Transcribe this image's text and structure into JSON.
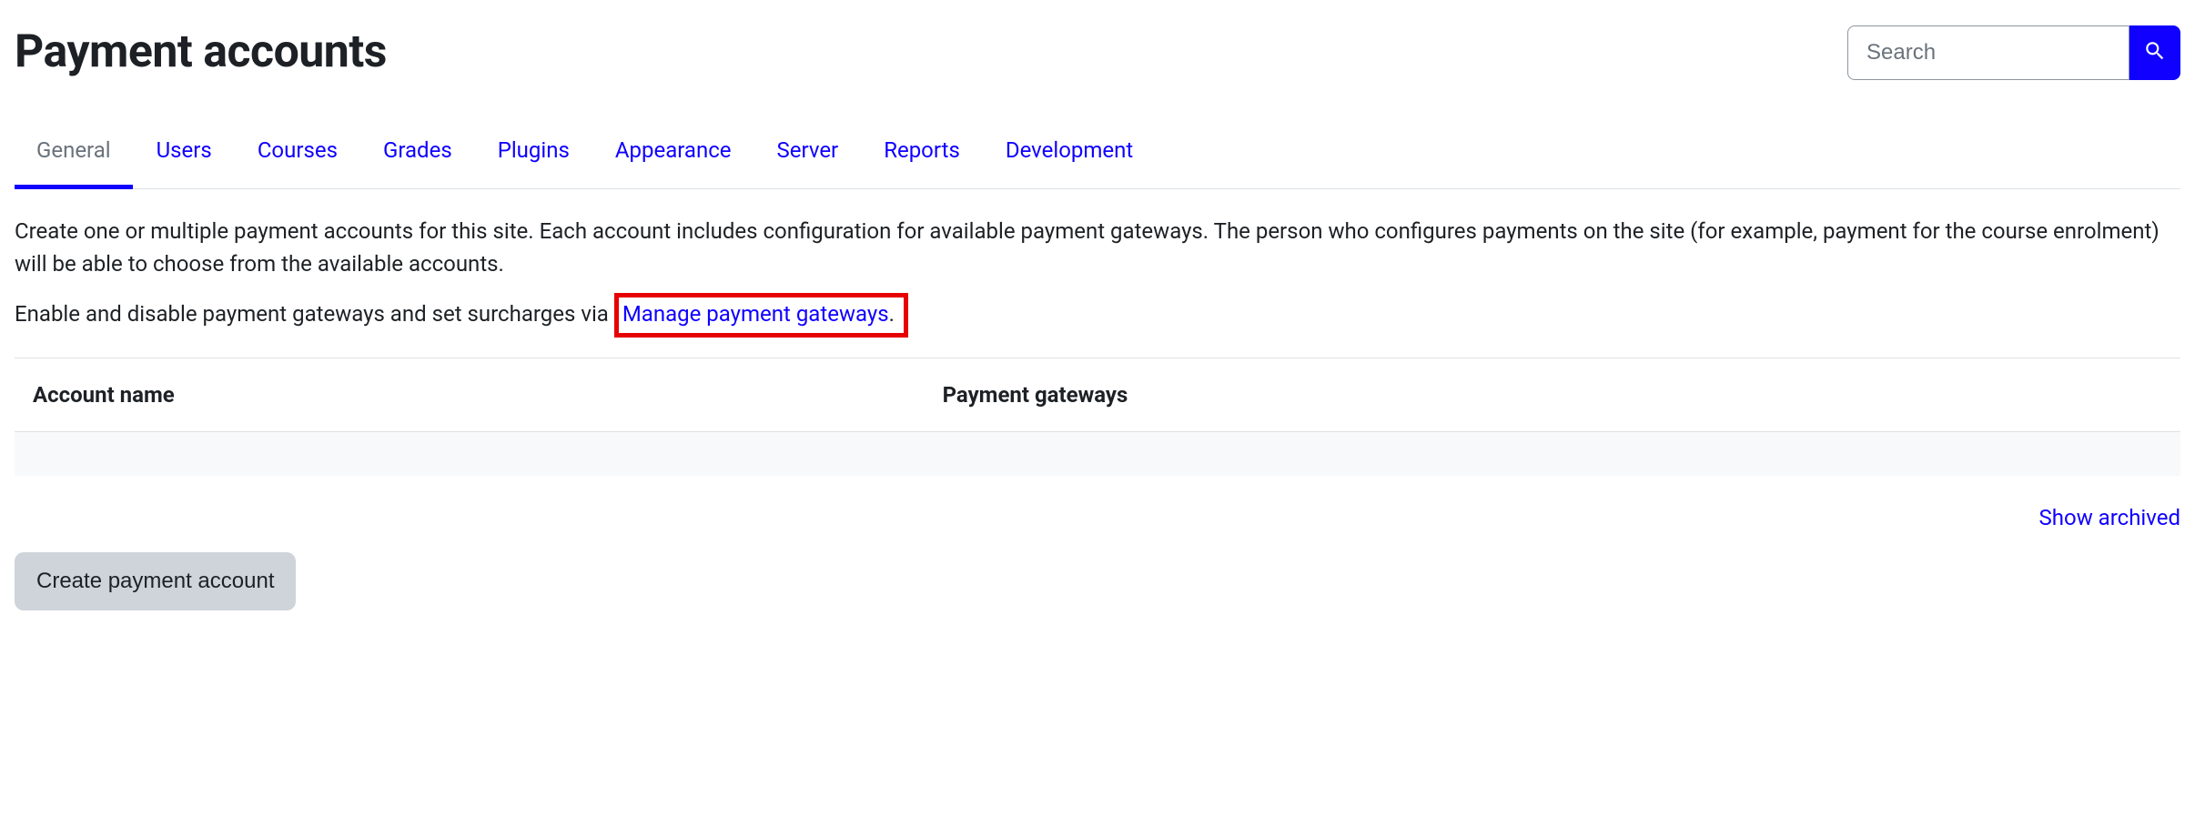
{
  "header": {
    "title": "Payment accounts",
    "search_placeholder": "Search"
  },
  "tabs": [
    {
      "label": "General",
      "active": true
    },
    {
      "label": "Users"
    },
    {
      "label": "Courses"
    },
    {
      "label": "Grades"
    },
    {
      "label": "Plugins"
    },
    {
      "label": "Appearance"
    },
    {
      "label": "Server"
    },
    {
      "label": "Reports"
    },
    {
      "label": "Development"
    }
  ],
  "description": {
    "para1": "Create one or multiple payment accounts for this site. Each account includes configuration for available payment gateways. The person who configures payments on the site (for example, payment for the course enrolment) will be able to choose from the available accounts.",
    "para2_prefix": "Enable and disable payment gateways and set surcharges via ",
    "para2_link": "Manage payment gateways",
    "para2_suffix": "."
  },
  "table": {
    "col1": "Account name",
    "col2": "Payment gateways"
  },
  "actions": {
    "show_archived": "Show archived",
    "create": "Create payment account"
  }
}
